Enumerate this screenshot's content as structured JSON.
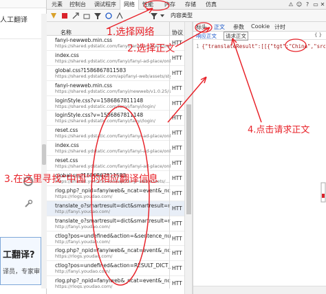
{
  "page": {
    "ai_label": "人工翻译",
    "big_title": "工翻译?",
    "big_sub": "译员，专家审"
  },
  "devtools_tabs": [
    "元素",
    "控制台",
    "调试程序",
    "网络",
    "性能",
    "内存",
    "存储",
    "仿真"
  ],
  "devtools_active_tab": "网络",
  "toolbar": {
    "content_type_label": "内容类型"
  },
  "list_header": {
    "name": "名称",
    "protocol": "协议"
  },
  "requests": [
    {
      "name": "fanyi-newweb.min.css",
      "path": "https://shared.ydstatic.com/fanyi/fanyi-ad-place/online/...",
      "proto": "HTT"
    },
    {
      "name": "index.css",
      "path": "https://shared.ydstatic.com/fanyi/fanyi-ad-place/online/...",
      "proto": "HTT"
    },
    {
      "name": "global.css?1586867811583",
      "path": "https://shared.ydstatic.com/api/fanyi-web/assets/styles/...",
      "proto": "HTT"
    },
    {
      "name": "fanyi-newweb.min.css",
      "path": "https://shared.ydstatic.com/fanyi/newweb/v1.0.25/styles/...",
      "proto": "HTT"
    },
    {
      "name": "loginStyle.css?v=1586867811148",
      "path": "https://shared.ydstatic.com/fanyi/fanyi/login/",
      "proto": "HTT"
    },
    {
      "name": "loginStyle.css?v=1586867811148",
      "path": "https://shared.ydstatic.com/fanyi/fanyi/login/",
      "proto": "HTT"
    },
    {
      "name": "reset.css",
      "path": "https://shared.ydstatic.com/fanyi/fanyi-ad-place/online/...",
      "proto": "HTT"
    },
    {
      "name": "index.css",
      "path": "https://shared.ydstatic.com/fanyi/fanyi-ad-place/online/...",
      "proto": "HTT"
    },
    {
      "name": "reset.css",
      "path": "https://shared.ydstatic.com/fanyi/fanyi-ad-place/online/...",
      "proto": "HTT"
    },
    {
      "name": "global.css?1586867811583",
      "path": "https://shared.ydstatic.com/api/fanyi-web/assets/...",
      "proto": "HTT"
    },
    {
      "name": "rlog.php?_npid=fanyiweb&_ncat=event&_ncoo=12...",
      "path": "https://rlogs.youdao.com/",
      "proto": "HTT"
    },
    {
      "name": "translate_o?smartresult=dict&smartresult=rule",
      "path": "http://fanyi.youdao.com/",
      "proto": "HTT",
      "selected": true
    },
    {
      "name": "translate_o?smartresult=dict&smartresult=rule",
      "path": "http://fanyi.youdao.com/",
      "proto": "HTT"
    },
    {
      "name": "ctlog?pos=undefined&action=&sentence_number...",
      "path": "http://fanyi.youdao.com/",
      "proto": "HTT"
    },
    {
      "name": "rlog.php?_npid=fanyiweb&_ncat=event&_ncoo=12...",
      "path": "https://rlogs.youdao.com/",
      "proto": "HTT"
    },
    {
      "name": "ctlog?pos=undefined&action=RESULT_DICT_SHOW",
      "path": "http://fanyi.youdao.com/",
      "proto": "HTT"
    },
    {
      "name": "rlog.php?_npid=fanyiweb&_ncat=event&_ncoo=12...",
      "path": "https://rlogs.youdao.com/",
      "proto": "HTT"
    }
  ],
  "detail_tabs": [
    {
      "label": "标头",
      "active": false
    },
    {
      "label": "正文",
      "active": true
    },
    {
      "label": "参数",
      "active": false
    },
    {
      "label": "Cookie",
      "active": false
    },
    {
      "label": "计时",
      "active": false
    }
  ],
  "sub_tabs": [
    {
      "label": "响应正文",
      "active": true
    },
    {
      "label": "请求正文",
      "active": false
    }
  ],
  "code": {
    "line_no": "1",
    "text": "{\"translateResult\":[[{\"tgt\":\"China\",\"src\":\"中国\"}]]"
  },
  "annotations": {
    "step1": "1.选择网络",
    "step2": "2.选择正文",
    "step3": "3.在这里寻找“中国”的相应翻译信息",
    "step4": "4.点击请求正文"
  },
  "colors": {
    "annotation": "#e8232a",
    "selected_row": "#e8eef7",
    "active_tab": "#1a56c8"
  }
}
